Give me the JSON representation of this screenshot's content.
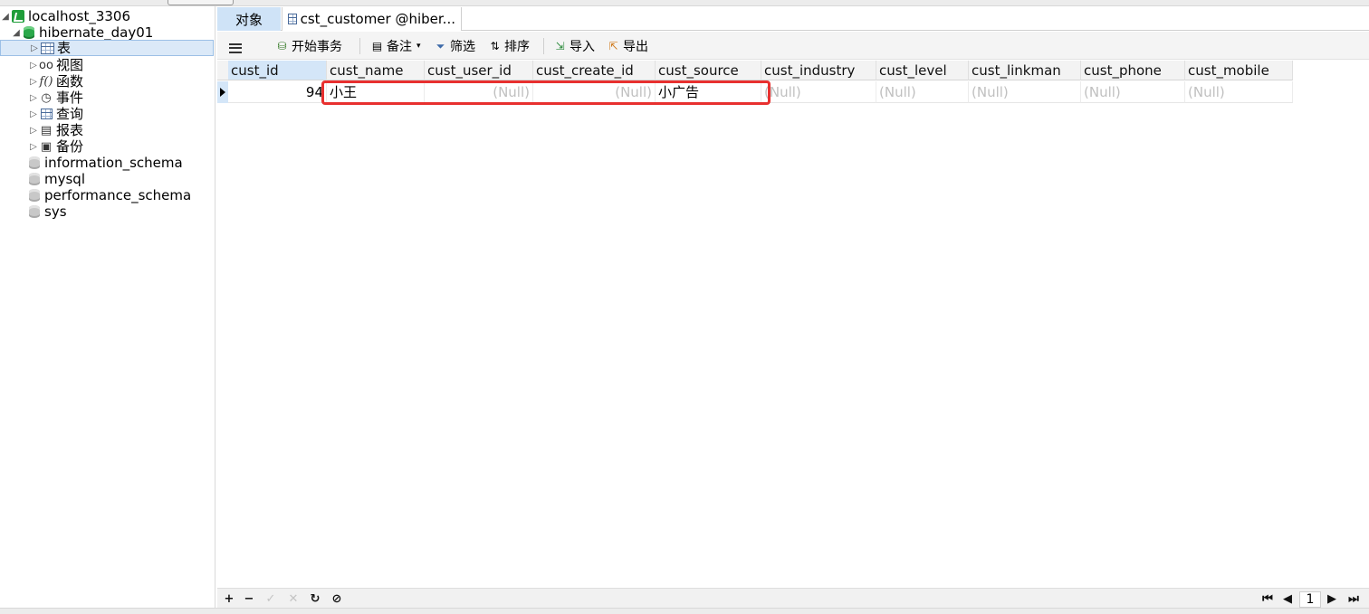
{
  "sidebar": {
    "connection": {
      "label": "localhost_3306",
      "icon": "server-icon"
    },
    "database": {
      "label": "hibernate_day01",
      "icon": "database-icon"
    },
    "nodes": [
      {
        "label": "表",
        "icon": "table-icon",
        "selected": true
      },
      {
        "label": "视图",
        "icon": "view-icon"
      },
      {
        "label": "函数",
        "icon": "function-icon"
      },
      {
        "label": "事件",
        "icon": "event-icon"
      },
      {
        "label": "查询",
        "icon": "query-icon"
      },
      {
        "label": "报表",
        "icon": "report-icon"
      },
      {
        "label": "备份",
        "icon": "backup-icon"
      }
    ],
    "other_databases": [
      "information_schema",
      "mysql",
      "performance_schema",
      "sys"
    ]
  },
  "tabs": [
    {
      "label": "对象",
      "active": true
    },
    {
      "label": "cst_customer @hiber...",
      "icon": "table-icon"
    }
  ],
  "toolbar": {
    "menu_icon": "hamburger-icon",
    "begin_transaction": "开始事务",
    "memo": "备注",
    "filter": "筛选",
    "sort": "排序",
    "import": "导入",
    "export": "导出"
  },
  "grid": {
    "columns": [
      "cust_id",
      "cust_name",
      "cust_user_id",
      "cust_create_id",
      "cust_source",
      "cust_industry",
      "cust_level",
      "cust_linkman",
      "cust_phone",
      "cust_mobile"
    ],
    "rows": [
      [
        "94",
        "小王",
        "(Null)",
        "(Null)",
        "小广告",
        "(Null)",
        "(Null)",
        "(Null)",
        "(Null)",
        "(Null)"
      ]
    ]
  },
  "pager": {
    "page": "1"
  },
  "colors": {
    "highlight": "#e8302f",
    "selection": "#d4e6f8",
    "null_text": "#c0c0c0"
  }
}
